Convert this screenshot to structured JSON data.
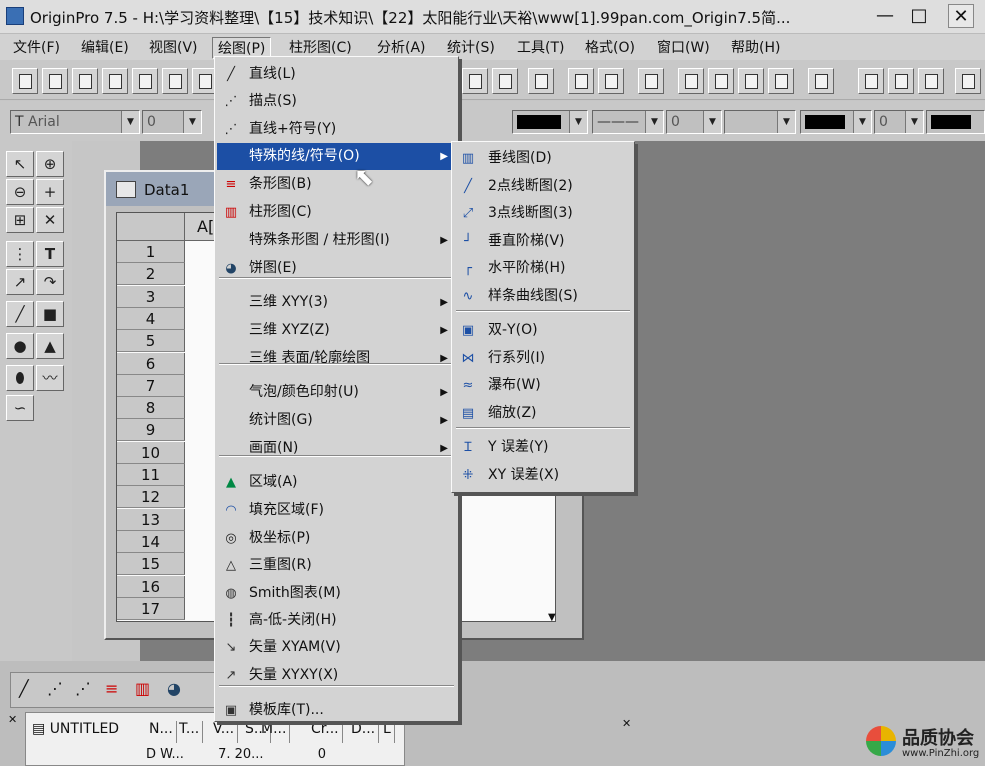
{
  "window": {
    "title": "OriginPro 7.5 - H:\\学习资料整理\\【15】技术知识\\【22】太阳能行业\\天裕\\www[1].99pan.com_Origin7.5简...",
    "minimize": "—",
    "maximize": "□",
    "close": "✕"
  },
  "menubar": {
    "items": [
      {
        "label": "文件(F)"
      },
      {
        "label": "编辑(E)"
      },
      {
        "label": "视图(V)"
      },
      {
        "label": "绘图(P)"
      },
      {
        "label": "柱形图(C)"
      },
      {
        "label": "分析(A)"
      },
      {
        "label": "统计(S)"
      },
      {
        "label": "工具(T)"
      },
      {
        "label": "格式(O)"
      },
      {
        "label": "窗口(W)"
      },
      {
        "label": "帮助(H)"
      }
    ]
  },
  "format_toolbar": {
    "font": "Arial",
    "font_size": "0",
    "line_width": "0",
    "symbol_size": "0"
  },
  "left_toolbar": {
    "text_tool": "T"
  },
  "data_window": {
    "title": "Data1",
    "column_header": "A[",
    "rows": [
      "1",
      "2",
      "3",
      "4",
      "5",
      "6",
      "7",
      "8",
      "9",
      "10",
      "11",
      "12",
      "13",
      "14",
      "15",
      "16",
      "17"
    ]
  },
  "plot_menu": {
    "items": [
      {
        "label": "直线(L)",
        "icon": "line-icon",
        "submenu": false
      },
      {
        "label": "描点(S)",
        "icon": "scatter-icon",
        "submenu": false
      },
      {
        "label": "直线+符号(Y)",
        "icon": "line-symbol-icon",
        "submenu": false
      },
      {
        "label": "特殊的线/符号(O)",
        "icon": "",
        "submenu": true,
        "selected": true
      },
      {
        "label": "条形图(B)",
        "icon": "bar-chart-icon",
        "submenu": false
      },
      {
        "label": "柱形图(C)",
        "icon": "column-chart-icon",
        "submenu": false
      },
      {
        "label": "特殊条形图 / 柱形图(I)",
        "icon": "",
        "submenu": true
      },
      {
        "label": "饼图(E)",
        "icon": "pie-chart-icon",
        "submenu": false
      },
      {
        "label": "三维  XYY(3)",
        "icon": "",
        "submenu": true
      },
      {
        "label": "三维 XYZ(Z)",
        "icon": "",
        "submenu": true
      },
      {
        "label": "三维 表面/轮廓绘图",
        "icon": "",
        "submenu": true
      },
      {
        "label": "气泡/颜色印射(U)",
        "icon": "",
        "submenu": true
      },
      {
        "label": "统计图(G)",
        "icon": "",
        "submenu": true
      },
      {
        "label": "画面(N)",
        "icon": "",
        "submenu": true
      },
      {
        "label": "区域(A)",
        "icon": "area-icon",
        "submenu": false
      },
      {
        "label": "填充区域(F)",
        "icon": "fill-area-icon",
        "submenu": false
      },
      {
        "label": "极坐标(P)",
        "icon": "polar-icon",
        "submenu": false
      },
      {
        "label": "三重图(R)",
        "icon": "ternary-icon",
        "submenu": false
      },
      {
        "label": "Smith图表(M)",
        "icon": "smith-chart-icon",
        "submenu": false
      },
      {
        "label": "高-低-关闭(H)",
        "icon": "high-low-close-icon",
        "submenu": false
      },
      {
        "label": "矢量 XYAM(V)",
        "icon": "vector-xyam-icon",
        "submenu": false
      },
      {
        "label": "矢量 XYXY(X)",
        "icon": "vector-xyxy-icon",
        "submenu": false
      },
      {
        "label": "模板库(T)...",
        "icon": "template-library-icon",
        "submenu": false
      }
    ]
  },
  "special_submenu": {
    "items": [
      {
        "label": "垂线图(D)",
        "icon": "drop-line-icon"
      },
      {
        "label": "2点线断图(2)",
        "icon": "two-point-segment-icon"
      },
      {
        "label": "3点线断图(3)",
        "icon": "three-point-segment-icon"
      },
      {
        "label": "垂直阶梯(V)",
        "icon": "vertical-step-icon"
      },
      {
        "label": "水平阶梯(H)",
        "icon": "horizontal-step-icon"
      },
      {
        "label": "样条曲线图(S)",
        "icon": "spline-icon"
      },
      {
        "label": "双-Y(O)",
        "icon": "double-y-icon"
      },
      {
        "label": "行系列(I)",
        "icon": "line-series-icon"
      },
      {
        "label": "瀑布(W)",
        "icon": "waterfall-icon"
      },
      {
        "label": "缩放(Z)",
        "icon": "zoom-icon"
      },
      {
        "label": "Y 误差(Y)",
        "icon": "y-error-icon"
      },
      {
        "label": "XY 误差(X)",
        "icon": "xy-error-icon"
      }
    ]
  },
  "project_explorer": {
    "folder": "UNTITLED",
    "columns": [
      "N...",
      "T...",
      "V...",
      "S...",
      "M...",
      "Cr...",
      "D...",
      "L"
    ],
    "row": [
      "D",
      "W...",
      "",
      "7.",
      "20...",
      "",
      "0",
      ""
    ]
  },
  "watermark": {
    "name": "品质协会",
    "url": "www.PinZhi.org"
  },
  "colors": {
    "menu_highlight": "#1c4fa5",
    "workspace": "#7d7d7d"
  }
}
